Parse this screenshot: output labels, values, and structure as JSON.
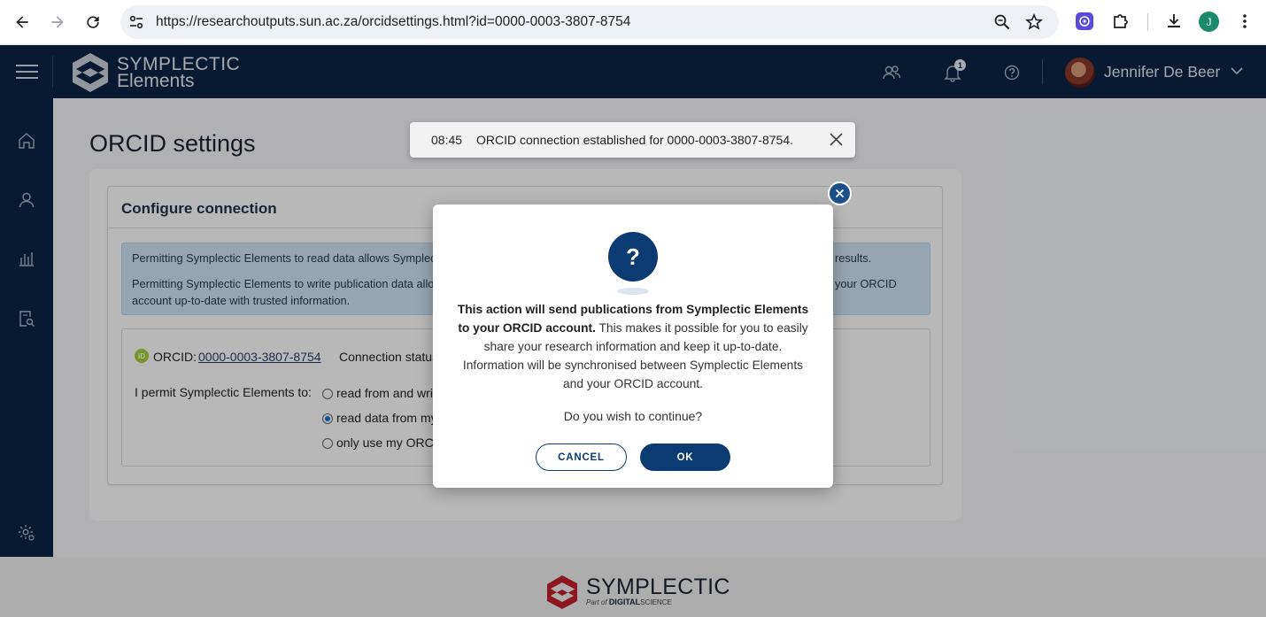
{
  "browser": {
    "url": "https://researchoutputs.sun.ac.za/orcidsettings.html?id=0000-0003-3807-8754",
    "profile_initial": "J"
  },
  "header": {
    "logo_line1": "SYMPLECTIC",
    "logo_line2": "Elements",
    "notification_count": "1",
    "user_name": "Jennifer De Beer"
  },
  "page": {
    "title": "ORCID settings",
    "card_title": "Configure connection",
    "info_line1": "Permitting Symplectic Elements to read data allows Symplec",
    "info_line1_end": "results.",
    "info_line2": "Permitting Symplectic Elements to write publication data allo",
    "info_line2_end": "your ORCID",
    "info_line3": "account up-to-date with trusted information.",
    "orcid_label": "ORCID:",
    "orcid_id": "0000-0003-3807-8754",
    "connection_status": "Connection status",
    "permit_label": "I permit Symplectic Elements to:",
    "options": [
      {
        "label": "read from and writ",
        "checked": false
      },
      {
        "label": "read data from my",
        "checked": true
      },
      {
        "label": "only use my ORCI",
        "checked": false
      }
    ]
  },
  "toast": {
    "time": "08:45",
    "message": "ORCID connection established for 0000-0003-3807-8754."
  },
  "modal": {
    "icon": "?",
    "bold_text": "This action will send publications from Symplectic Elements to your ORCID account.",
    "body_text": " This makes it possible for you to easily share your research information and keep it up-to-date. Information will be synchronised between Symplectic Elements and your ORCID account.",
    "question": "Do you wish to continue?",
    "cancel_label": "CANCEL",
    "ok_label": "OK"
  },
  "footer": {
    "brand": "SYMPLECTIC",
    "sub_prefix": "Part of",
    "sub_brand1": "DIGITAL",
    "sub_brand2": "SCIENCE"
  },
  "colors": {
    "navy": "#0b2545",
    "button_blue": "#0b3b72",
    "info_bg": "#cfe6f7",
    "orcid_green": "#a6ce39"
  }
}
